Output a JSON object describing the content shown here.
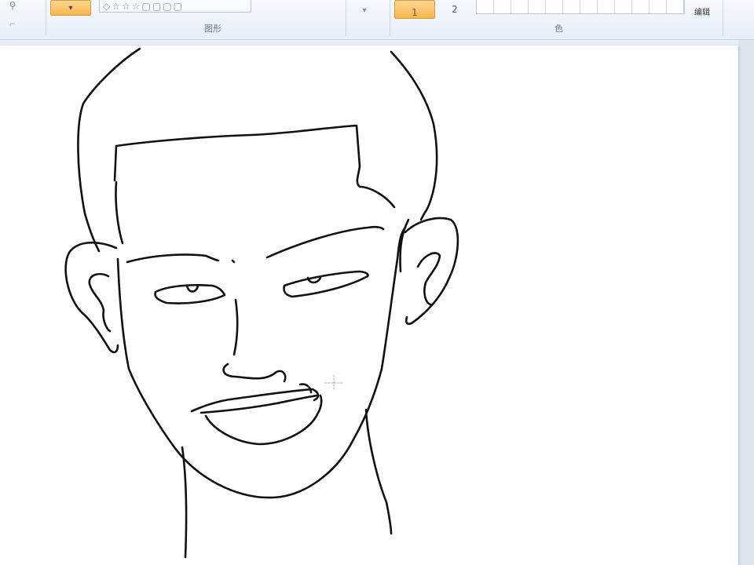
{
  "ribbon": {
    "groups": [
      {
        "label": "图形"
      },
      {
        "label": "色"
      }
    ],
    "stroke_width_options": [
      "1",
      "2"
    ],
    "edit_colors_label": "编辑",
    "shape_glyphs": [
      "◇",
      "☆",
      "☆",
      "☆",
      "▢",
      "▢",
      "▢",
      "▢"
    ],
    "accent_color": "#f9b548",
    "icons": [
      "magnifier-icon",
      "shape-gallery-icon",
      "palette-icon",
      "brush-cursor-icon"
    ]
  },
  "canvas": {
    "background": "#ffffff",
    "stroke_color": "#111111",
    "subject": "line-drawing-face"
  }
}
